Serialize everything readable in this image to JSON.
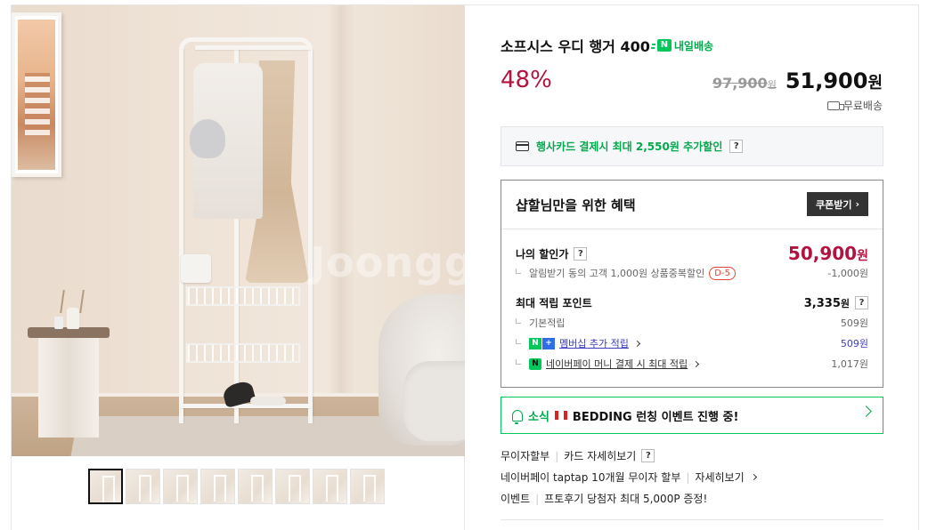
{
  "gallery": {
    "watermark": "Joongg",
    "thumbnail_count": 8,
    "active_thumbnail": 1
  },
  "product": {
    "title": "소프시스 우디 행거 400",
    "delivery_badge_icon": "N",
    "delivery_badge": "내일배송",
    "discount": "48%",
    "original_price": "97,900",
    "original_unit": "원",
    "sale_price": "51,900",
    "sale_unit": "원",
    "shipping": "무료배송"
  },
  "card_promo": {
    "text": "행사카드 결제시 최대 2,550원 추가할인",
    "help": "?"
  },
  "benefit": {
    "title": "샵할님만을 위한 혜택",
    "coupon_button": "쿠폰받기",
    "my_discount_label": "나의 할인가",
    "my_discount_help": "?",
    "my_price": "50,900",
    "my_price_unit": "원",
    "alarm_text": "알림받기 동의 고객 1,000원 상품중복할인",
    "alarm_dday": "D-5",
    "alarm_value": "-1,000원",
    "points_label": "최대 적립 포인트",
    "points_value": "3,335",
    "points_unit": "원",
    "points_help": "?",
    "basic_label": "기본적립",
    "basic_value": "509원",
    "membership_icon_n": "N",
    "membership_icon_plus": "+",
    "membership_label": "멤버십 추가 적립",
    "membership_value": "509원",
    "npay_icon": "N",
    "npay_label": "네이버페이 머니 결제 시 최대 적립",
    "npay_value": "1,017원"
  },
  "news": {
    "label": "소식",
    "text": "BEDDING 런칭 이벤트 진행 중!"
  },
  "extras": {
    "installment_label": "무이자할부",
    "card_detail": "카드 자세히보기",
    "card_help": "?",
    "taptap": "네이버페이 taptap 10개월 무이자 할부",
    "taptap_detail": "자세히보기",
    "event_label": "이벤트",
    "event_text": "프토후기 당첨자 최대 5,000P 증정!"
  },
  "colors": {
    "discount_red": "#b0143f",
    "naver_green": "#03c75a",
    "link_blue": "#3b3bbd"
  }
}
